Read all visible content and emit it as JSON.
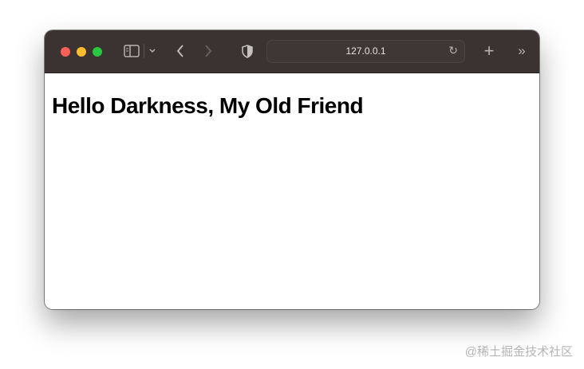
{
  "browser": {
    "url": "127.0.0.1",
    "colors": {
      "close": "#fe5f57",
      "minimize": "#febc2e",
      "zoom": "#28c840",
      "toolbar": "#3b3331"
    }
  },
  "page": {
    "heading": "Hello Darkness, My Old Friend"
  },
  "watermark": "@稀土掘金技术社区"
}
